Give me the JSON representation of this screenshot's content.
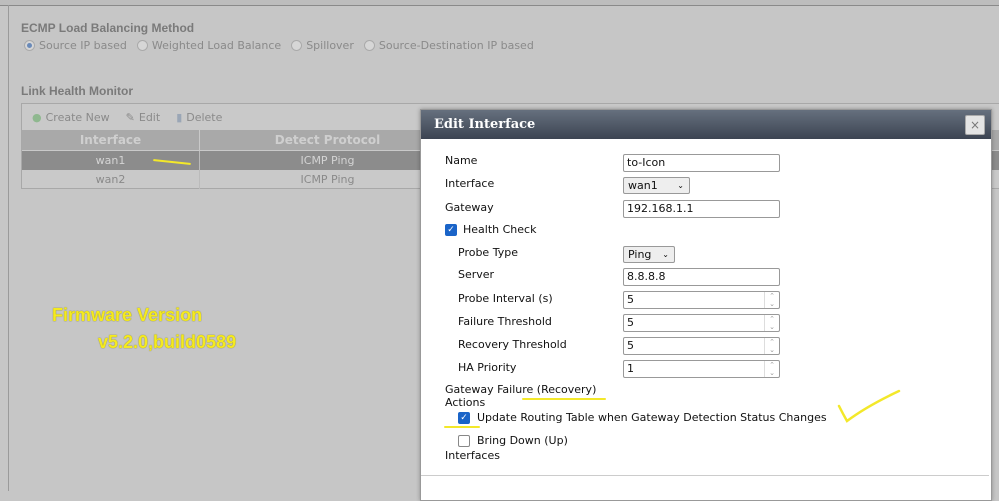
{
  "ecmp": {
    "title": "ECMP Load Balancing Method",
    "options": [
      "Source IP based",
      "Weighted Load Balance",
      "Spillover",
      "Source-Destination IP based"
    ],
    "selected": 0
  },
  "lhm": {
    "title": "Link Health Monitor",
    "toolbar": {
      "create": "Create New",
      "edit": "Edit",
      "delete": "Delete"
    },
    "columns": [
      "Interface",
      "Detect Protocol"
    ],
    "rows": [
      [
        "wan1",
        "ICMP Ping"
      ],
      [
        "wan2",
        "ICMP Ping"
      ]
    ]
  },
  "annotation": {
    "line1": "Firmware Version",
    "line2": "v5.2.0,build0589"
  },
  "dialog": {
    "title": "Edit Interface",
    "close": "×",
    "name_label": "Name",
    "name_value": "to-Icon",
    "interface_label": "Interface",
    "interface_value": "wan1",
    "gateway_label": "Gateway",
    "gateway_value": "192.168.1.1",
    "health_check": "Health Check",
    "probe_type_label": "Probe Type",
    "probe_type_value": "Ping",
    "server_label": "Server",
    "server_value": "8.8.8.8",
    "probe_interval_label": "Probe Interval (s)",
    "probe_interval_value": "5",
    "failure_label": "Failure Threshold",
    "failure_value": "5",
    "recovery_label": "Recovery Threshold",
    "recovery_value": "5",
    "ha_label": "HA Priority",
    "ha_value": "1",
    "gf_label1": "Gateway Failure (Recovery)",
    "gf_label2": "Actions",
    "update_routing": "Update Routing Table when Gateway Detection Status Changes",
    "bring_down": "Bring Down (Up)",
    "interfaces": "Interfaces"
  }
}
